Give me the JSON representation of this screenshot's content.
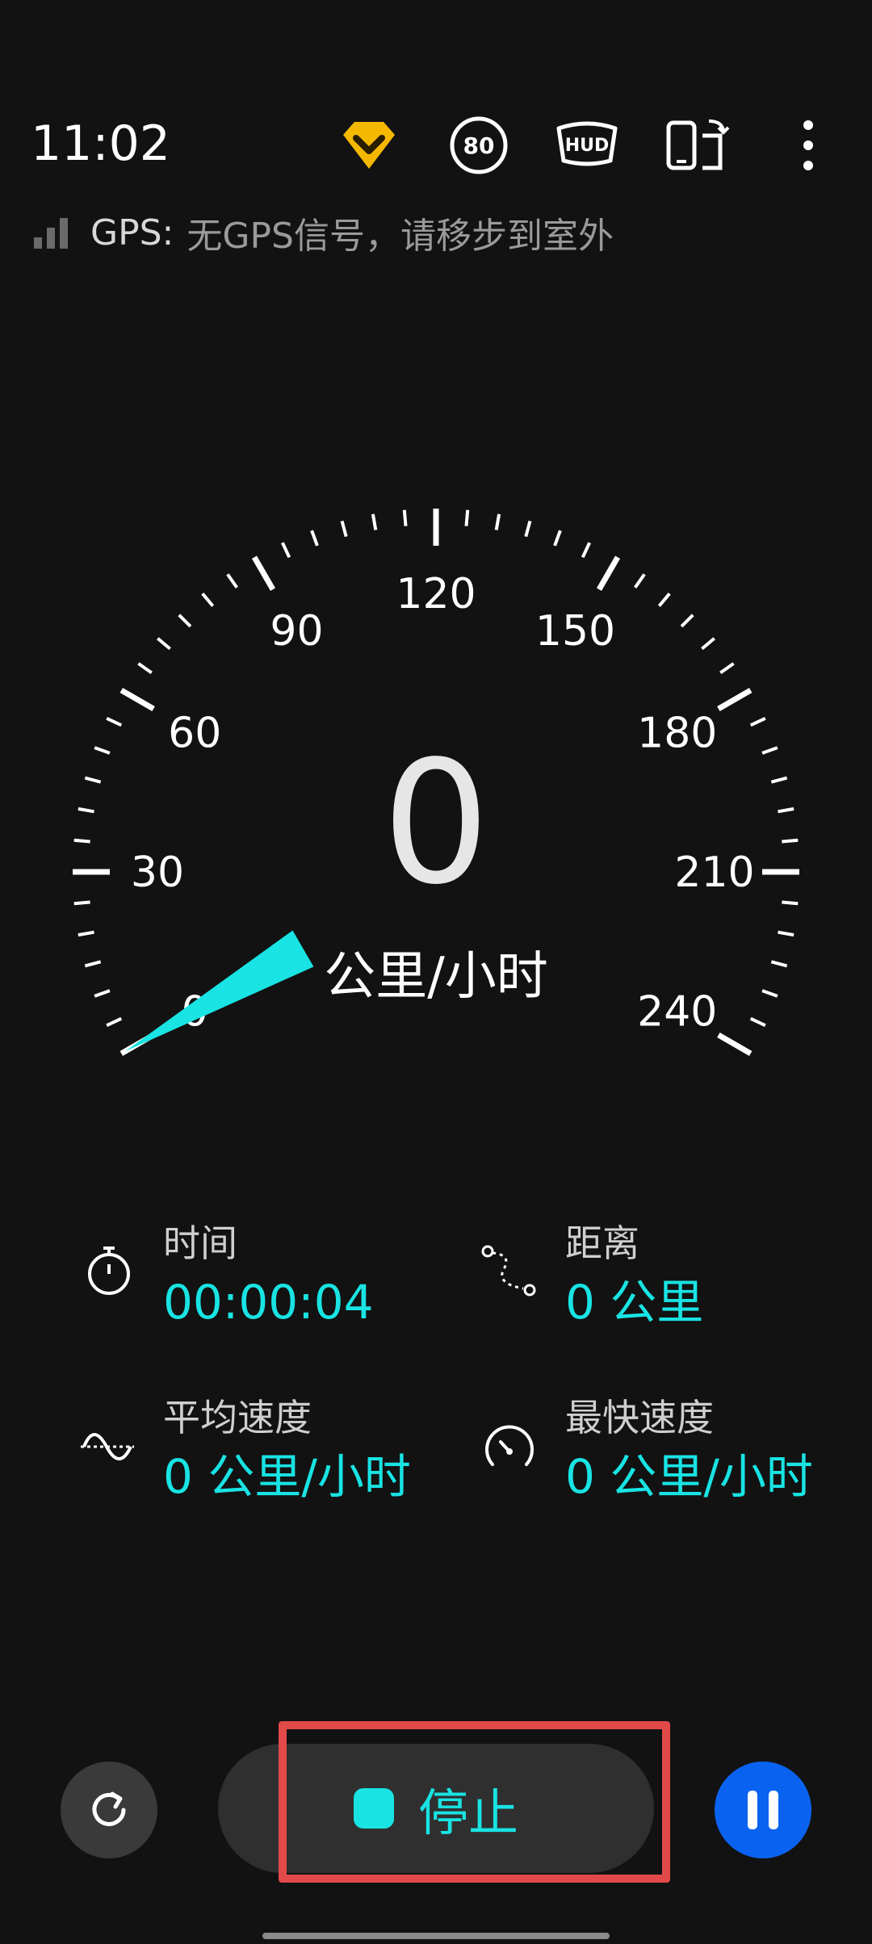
{
  "status": {
    "time": "11:02"
  },
  "toolbar": {
    "badge_icon": "premium-chevron-icon",
    "speed_limit": "80",
    "hud": "HUD",
    "rotate_icon": "screen-rotate-icon",
    "more_icon": "more-vertical-icon",
    "accent": "#f5b800"
  },
  "gps": {
    "label": "GPS:",
    "message": "无GPS信号，请移步到室外"
  },
  "gauge": {
    "value": "0",
    "unit": "公里/小时",
    "min": 0,
    "max": 240,
    "current": 0,
    "ticks": [
      "0",
      "30",
      "60",
      "90",
      "120",
      "150",
      "180",
      "210",
      "240"
    ],
    "needle_color": "#19e3e3"
  },
  "stats": {
    "time": {
      "label": "时间",
      "value": "00:00:04",
      "icon": "stopwatch-icon"
    },
    "distance": {
      "label": "距离",
      "value": "0 公里",
      "icon": "route-icon"
    },
    "avg_speed": {
      "label": "平均速度",
      "value": "0 公里/小时",
      "icon": "wave-icon"
    },
    "max_speed": {
      "label": "最快速度",
      "value": "0 公里/小时",
      "icon": "speedometer-icon"
    }
  },
  "controls": {
    "reset_icon": "refresh-icon",
    "stop_label": "停止",
    "pause_icon": "pause-icon",
    "accent": "#19e3e3",
    "pause_color": "#0a63f0"
  }
}
